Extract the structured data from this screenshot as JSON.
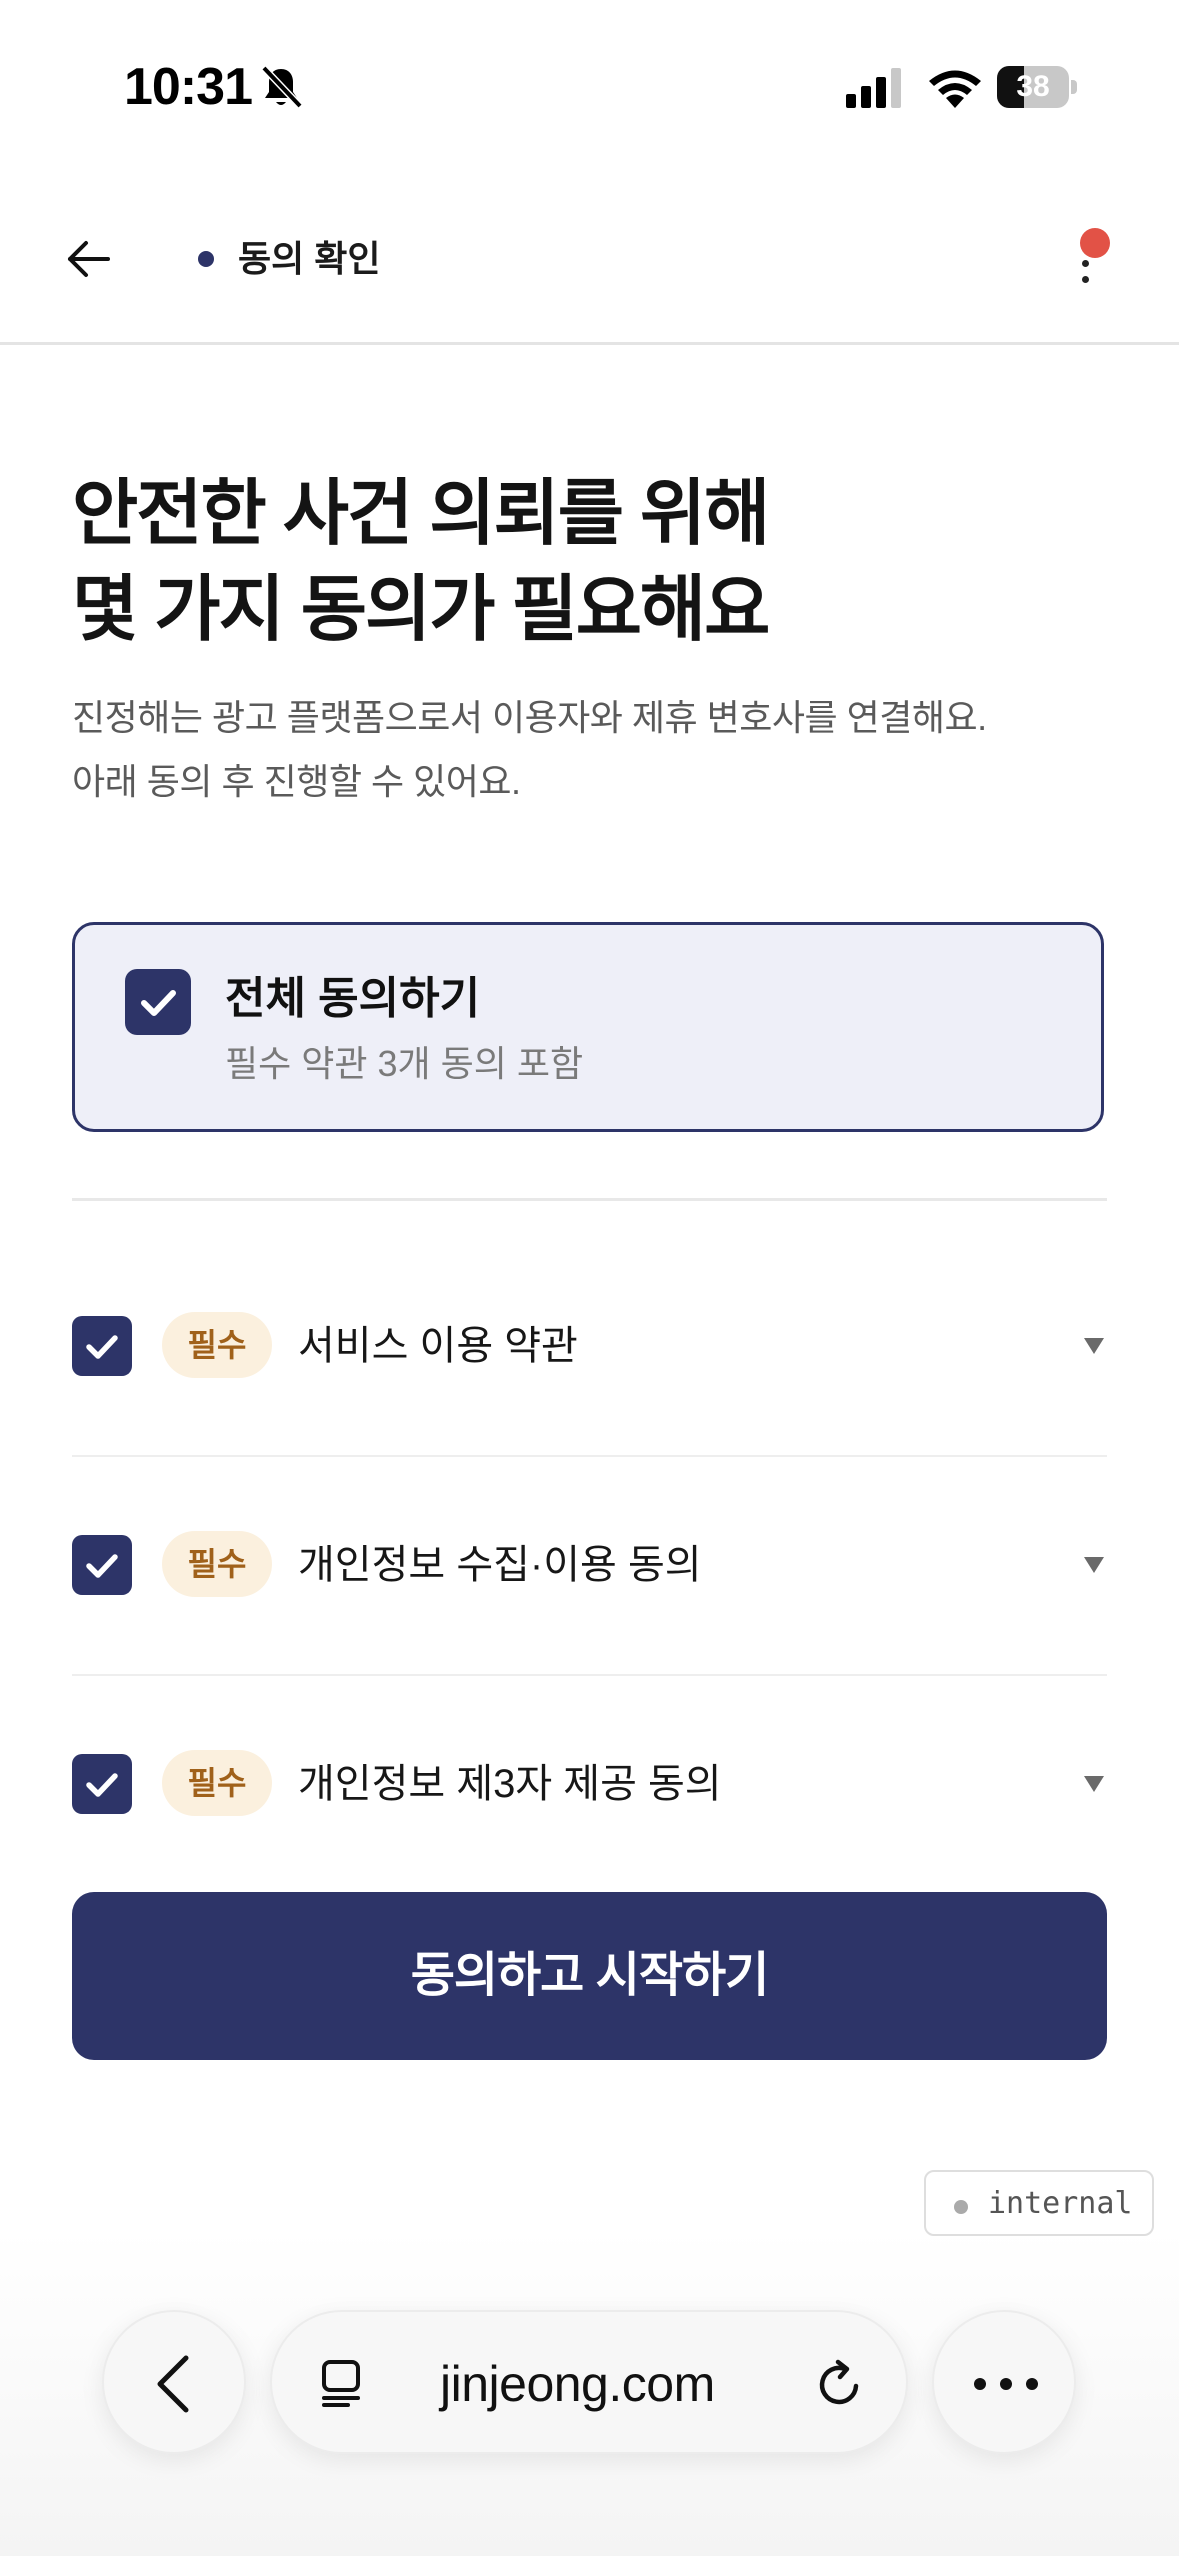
{
  "status_bar": {
    "time": "10:31",
    "battery": "38",
    "battery_level": 0.38
  },
  "header": {
    "title": "동의 확인",
    "has_notification": true
  },
  "heading": {
    "line1": "안전한 사건 의뢰를 위해",
    "line2": "몇 가지 동의가 필요해요"
  },
  "description": {
    "line1": "진정해는 광고 플랫폼으로서 이용자와 제휴 변호사를 연결해요.",
    "line2": "아래 동의 후 진행할 수 있어요."
  },
  "agree_all": {
    "title": "전체 동의하기",
    "subtitle": "필수 약관 3개 동의 포함",
    "checked": true
  },
  "terms": [
    {
      "badge": "필수",
      "label": "서비스 이용 약관",
      "checked": true
    },
    {
      "badge": "필수",
      "label": "개인정보 수집·이용 동의",
      "checked": true
    },
    {
      "badge": "필수",
      "label": "개인정보 제3자 제공 동의",
      "checked": true
    }
  ],
  "cta": {
    "label": "동의하고 시작하기"
  },
  "env_tag": {
    "label": "internal"
  },
  "browser": {
    "url": "jinjeong.com"
  },
  "colors": {
    "primary": "#2d3468",
    "badge_bg": "#fbf0de",
    "badge_text": "#a0611a",
    "notification": "#e25246"
  }
}
